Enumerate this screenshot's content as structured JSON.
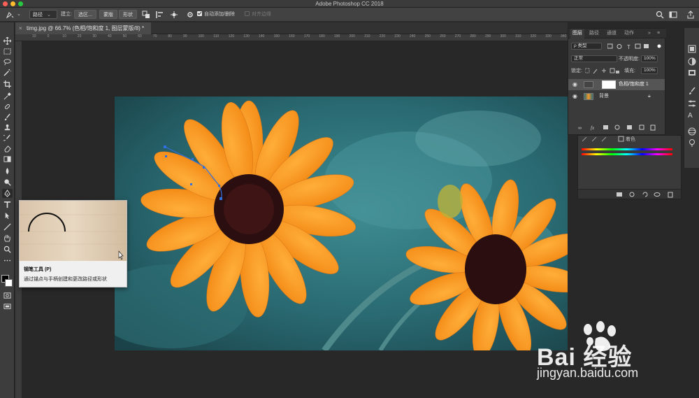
{
  "window": {
    "title": "Adobe Photoshop CC 2018",
    "colors": {
      "close": "#ff5f57",
      "minimize": "#febc2e",
      "maximize": "#28c840"
    }
  },
  "options": {
    "mode": "路径",
    "make_label": "建立:",
    "selection_button": "选区...",
    "mask_button": "蒙版",
    "shape_button": "形状",
    "auto_add_delete": "自动添加/删除",
    "align_edges": "对齐边缘"
  },
  "document": {
    "tab_label": "timg.jpg @ 66.7% (色相/饱和度 1, 图层蒙版/8) *",
    "ruler_marks": [
      "10",
      "0",
      "10",
      "20",
      "30",
      "40",
      "50",
      "60",
      "70",
      "80",
      "90",
      "100",
      "110",
      "120",
      "130",
      "140",
      "150",
      "160",
      "170",
      "180",
      "190",
      "200",
      "210",
      "220",
      "230",
      "240",
      "250",
      "260",
      "270",
      "280",
      "290",
      "300",
      "310",
      "320",
      "330",
      "340"
    ]
  },
  "tooltip": {
    "name": "钢笔工具 (P)",
    "description": "通过锚点与手柄创建和更改路径或形状"
  },
  "layers": {
    "tabs": [
      "图层",
      "路径",
      "通道",
      "动作"
    ],
    "filter_label": "ρ 类型",
    "blend_mode": "正常",
    "opacity_label": "不透明度:",
    "opacity_value": "100%",
    "lock_label": "锁定:",
    "fill_label": "填充:",
    "fill_value": "100%",
    "items": [
      {
        "name": "色相/饱和度 1",
        "selected": true
      },
      {
        "name": "背景",
        "selected": false
      }
    ]
  },
  "adjustments": {
    "checkbox_label": "着色"
  },
  "watermark": {
    "brand_text": "Bai 经验",
    "url": "jingyan.baidu.com"
  }
}
